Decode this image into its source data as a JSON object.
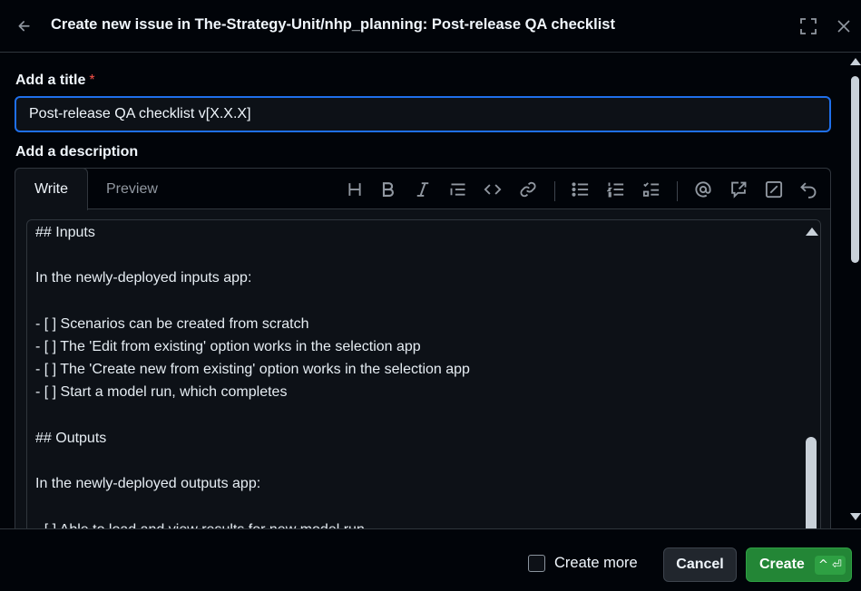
{
  "header": {
    "title": "Create new issue in The-Strategy-Unit/nhp_planning: Post-release QA checklist"
  },
  "form": {
    "title_label": "Add a title",
    "required_marker": "*",
    "title_value": "Post-release QA checklist v[X.X.X]",
    "description_label": "Add a description"
  },
  "editor": {
    "tabs": {
      "write": "Write",
      "preview": "Preview"
    },
    "toolbar_icons": [
      "heading-icon",
      "bold-icon",
      "italic-icon",
      "quote-icon",
      "code-icon",
      "link-icon",
      "bulleted-list-icon",
      "numbered-list-icon",
      "task-list-icon",
      "mention-icon",
      "reference-icon",
      "saved-replies-icon",
      "undo-icon"
    ],
    "content": "## Inputs\n\nIn the newly-deployed inputs app:\n\n- [ ] Scenarios can be created from scratch\n- [ ] The 'Edit from existing' option works in the selection app\n- [ ] The 'Create new from existing' option works in the selection app\n- [ ] Start a model run, which completes\n\n## Outputs\n\nIn the newly-deployed outputs app:\n\n- [ ] Able to load and view results for new model run"
  },
  "footer": {
    "create_more_label": "Create more",
    "cancel_label": "Cancel",
    "create_label": "Create",
    "create_shortcut": "^ ⏎"
  },
  "colors": {
    "background": "#010409",
    "focus_border": "#1f6feb",
    "primary_button": "#238636",
    "required": "#f85149"
  }
}
